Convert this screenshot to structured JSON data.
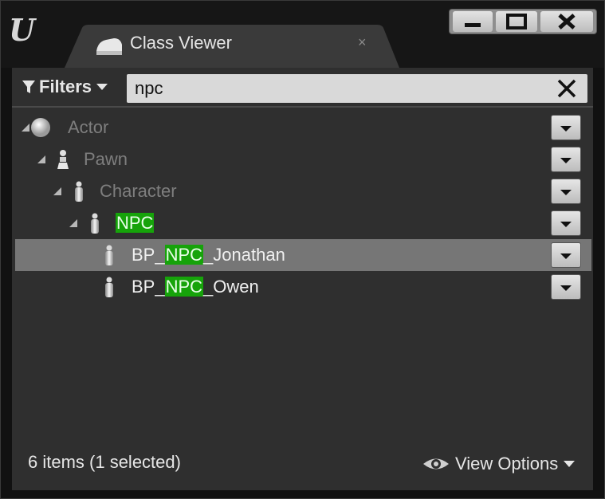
{
  "window": {
    "tab_title": "Class Viewer",
    "tab_close": "×",
    "logo_text": "U"
  },
  "filter_bar": {
    "filters_label": "Filters",
    "search_value": "npc"
  },
  "tree": [
    {
      "prefix": "",
      "match": "",
      "suffix": "Actor",
      "icon": "sphere-icon",
      "expanded": true
    },
    {
      "prefix": "",
      "match": "",
      "suffix": "Pawn",
      "icon": "pawn-icon",
      "expanded": true
    },
    {
      "prefix": "",
      "match": "",
      "suffix": "Character",
      "icon": "character-icon",
      "expanded": true
    },
    {
      "prefix": "",
      "match": "NPC",
      "suffix": "",
      "icon": "character-icon",
      "expanded": true
    },
    {
      "prefix": "BP_",
      "match": "NPC",
      "suffix": "_Jonathan",
      "icon": "character-icon",
      "selected": true
    },
    {
      "prefix": "BP_",
      "match": "NPC",
      "suffix": "_Owen",
      "icon": "character-icon"
    }
  ],
  "status": {
    "count_text": "6 items (1 selected)",
    "view_options_label": "View Options"
  },
  "colors": {
    "highlight": "#16a30a",
    "selected_row": "#767676",
    "panel": "#2f2f2f"
  }
}
